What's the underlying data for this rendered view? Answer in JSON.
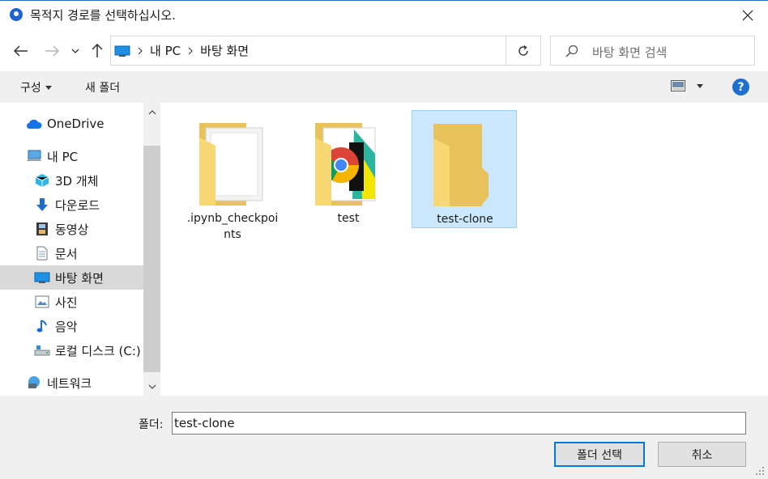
{
  "window": {
    "title": "목적지 경로를 선택하십시오.",
    "title_icon": "location-pin-icon",
    "close_icon": "close-icon"
  },
  "navigation": {
    "back_icon": "arrow-left-icon",
    "forward_icon": "arrow-right-icon",
    "recent_icon": "chevron-down-icon",
    "up_icon": "arrow-up-icon",
    "breadcrumb": [
      "내 PC",
      "바탕 화면"
    ],
    "refresh_icon": "refresh-icon",
    "search_placeholder": "바탕 화면 검색"
  },
  "toolbar": {
    "organize_label": "구성",
    "new_folder_label": "새 폴더",
    "help_label": "?"
  },
  "sidebar": {
    "items": [
      {
        "label": "OneDrive",
        "icon": "cloud-icon"
      },
      {
        "label": "내 PC",
        "icon": "computer-icon"
      },
      {
        "label": "3D 개체",
        "icon": "cube-icon"
      },
      {
        "label": "다운로드",
        "icon": "download-icon"
      },
      {
        "label": "동영상",
        "icon": "film-icon"
      },
      {
        "label": "문서",
        "icon": "document-icon"
      },
      {
        "label": "바탕 화면",
        "icon": "desktop-icon",
        "selected": true
      },
      {
        "label": "사진",
        "icon": "picture-icon"
      },
      {
        "label": "음악",
        "icon": "music-icon"
      },
      {
        "label": "로컬 디스크 (C:)",
        "icon": "drive-icon"
      },
      {
        "label": "네트워크",
        "icon": "network-icon"
      }
    ]
  },
  "files": [
    {
      "name": ".ipynb_checkpoints",
      "line1": ".ipynb_checkpoi",
      "line2": "nts",
      "icon": "folder-document-icon"
    },
    {
      "name": "test",
      "icon": "folder-chrome-icon"
    },
    {
      "name": "test-clone",
      "icon": "folder-icon",
      "selected": true
    }
  ],
  "footer": {
    "folder_label": "폴더:",
    "folder_value": "test-clone",
    "select_button": "폴더 선택",
    "cancel_button": "취소"
  },
  "colors": {
    "accent": "#0078d7",
    "selection": "#cce8ff",
    "folder": "#f8d775"
  }
}
